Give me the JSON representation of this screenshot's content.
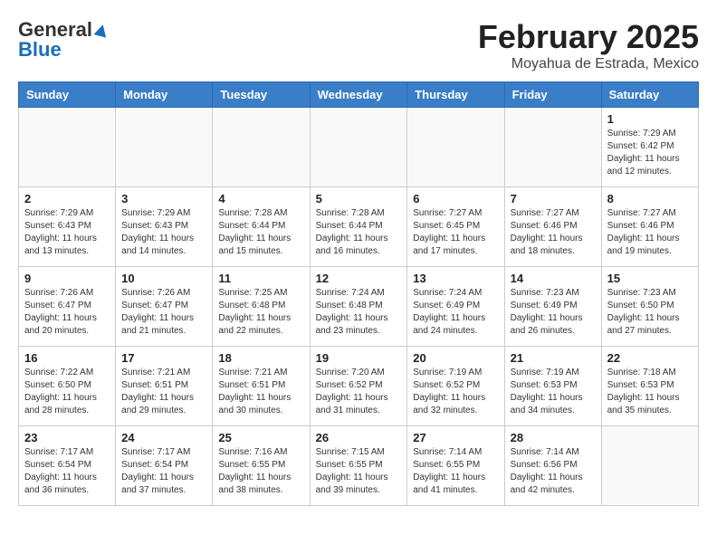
{
  "logo": {
    "line1": "General",
    "line2": "Blue"
  },
  "title": "February 2025",
  "location": "Moyahua de Estrada, Mexico",
  "days_of_week": [
    "Sunday",
    "Monday",
    "Tuesday",
    "Wednesday",
    "Thursday",
    "Friday",
    "Saturday"
  ],
  "weeks": [
    [
      {
        "day": "",
        "info": ""
      },
      {
        "day": "",
        "info": ""
      },
      {
        "day": "",
        "info": ""
      },
      {
        "day": "",
        "info": ""
      },
      {
        "day": "",
        "info": ""
      },
      {
        "day": "",
        "info": ""
      },
      {
        "day": "1",
        "info": "Sunrise: 7:29 AM\nSunset: 6:42 PM\nDaylight: 11 hours and 12 minutes."
      }
    ],
    [
      {
        "day": "2",
        "info": "Sunrise: 7:29 AM\nSunset: 6:43 PM\nDaylight: 11 hours and 13 minutes."
      },
      {
        "day": "3",
        "info": "Sunrise: 7:29 AM\nSunset: 6:43 PM\nDaylight: 11 hours and 14 minutes."
      },
      {
        "day": "4",
        "info": "Sunrise: 7:28 AM\nSunset: 6:44 PM\nDaylight: 11 hours and 15 minutes."
      },
      {
        "day": "5",
        "info": "Sunrise: 7:28 AM\nSunset: 6:44 PM\nDaylight: 11 hours and 16 minutes."
      },
      {
        "day": "6",
        "info": "Sunrise: 7:27 AM\nSunset: 6:45 PM\nDaylight: 11 hours and 17 minutes."
      },
      {
        "day": "7",
        "info": "Sunrise: 7:27 AM\nSunset: 6:46 PM\nDaylight: 11 hours and 18 minutes."
      },
      {
        "day": "8",
        "info": "Sunrise: 7:27 AM\nSunset: 6:46 PM\nDaylight: 11 hours and 19 minutes."
      }
    ],
    [
      {
        "day": "9",
        "info": "Sunrise: 7:26 AM\nSunset: 6:47 PM\nDaylight: 11 hours and 20 minutes."
      },
      {
        "day": "10",
        "info": "Sunrise: 7:26 AM\nSunset: 6:47 PM\nDaylight: 11 hours and 21 minutes."
      },
      {
        "day": "11",
        "info": "Sunrise: 7:25 AM\nSunset: 6:48 PM\nDaylight: 11 hours and 22 minutes."
      },
      {
        "day": "12",
        "info": "Sunrise: 7:24 AM\nSunset: 6:48 PM\nDaylight: 11 hours and 23 minutes."
      },
      {
        "day": "13",
        "info": "Sunrise: 7:24 AM\nSunset: 6:49 PM\nDaylight: 11 hours and 24 minutes."
      },
      {
        "day": "14",
        "info": "Sunrise: 7:23 AM\nSunset: 6:49 PM\nDaylight: 11 hours and 26 minutes."
      },
      {
        "day": "15",
        "info": "Sunrise: 7:23 AM\nSunset: 6:50 PM\nDaylight: 11 hours and 27 minutes."
      }
    ],
    [
      {
        "day": "16",
        "info": "Sunrise: 7:22 AM\nSunset: 6:50 PM\nDaylight: 11 hours and 28 minutes."
      },
      {
        "day": "17",
        "info": "Sunrise: 7:21 AM\nSunset: 6:51 PM\nDaylight: 11 hours and 29 minutes."
      },
      {
        "day": "18",
        "info": "Sunrise: 7:21 AM\nSunset: 6:51 PM\nDaylight: 11 hours and 30 minutes."
      },
      {
        "day": "19",
        "info": "Sunrise: 7:20 AM\nSunset: 6:52 PM\nDaylight: 11 hours and 31 minutes."
      },
      {
        "day": "20",
        "info": "Sunrise: 7:19 AM\nSunset: 6:52 PM\nDaylight: 11 hours and 32 minutes."
      },
      {
        "day": "21",
        "info": "Sunrise: 7:19 AM\nSunset: 6:53 PM\nDaylight: 11 hours and 34 minutes."
      },
      {
        "day": "22",
        "info": "Sunrise: 7:18 AM\nSunset: 6:53 PM\nDaylight: 11 hours and 35 minutes."
      }
    ],
    [
      {
        "day": "23",
        "info": "Sunrise: 7:17 AM\nSunset: 6:54 PM\nDaylight: 11 hours and 36 minutes."
      },
      {
        "day": "24",
        "info": "Sunrise: 7:17 AM\nSunset: 6:54 PM\nDaylight: 11 hours and 37 minutes."
      },
      {
        "day": "25",
        "info": "Sunrise: 7:16 AM\nSunset: 6:55 PM\nDaylight: 11 hours and 38 minutes."
      },
      {
        "day": "26",
        "info": "Sunrise: 7:15 AM\nSunset: 6:55 PM\nDaylight: 11 hours and 39 minutes."
      },
      {
        "day": "27",
        "info": "Sunrise: 7:14 AM\nSunset: 6:55 PM\nDaylight: 11 hours and 41 minutes."
      },
      {
        "day": "28",
        "info": "Sunrise: 7:14 AM\nSunset: 6:56 PM\nDaylight: 11 hours and 42 minutes."
      },
      {
        "day": "",
        "info": ""
      }
    ]
  ]
}
